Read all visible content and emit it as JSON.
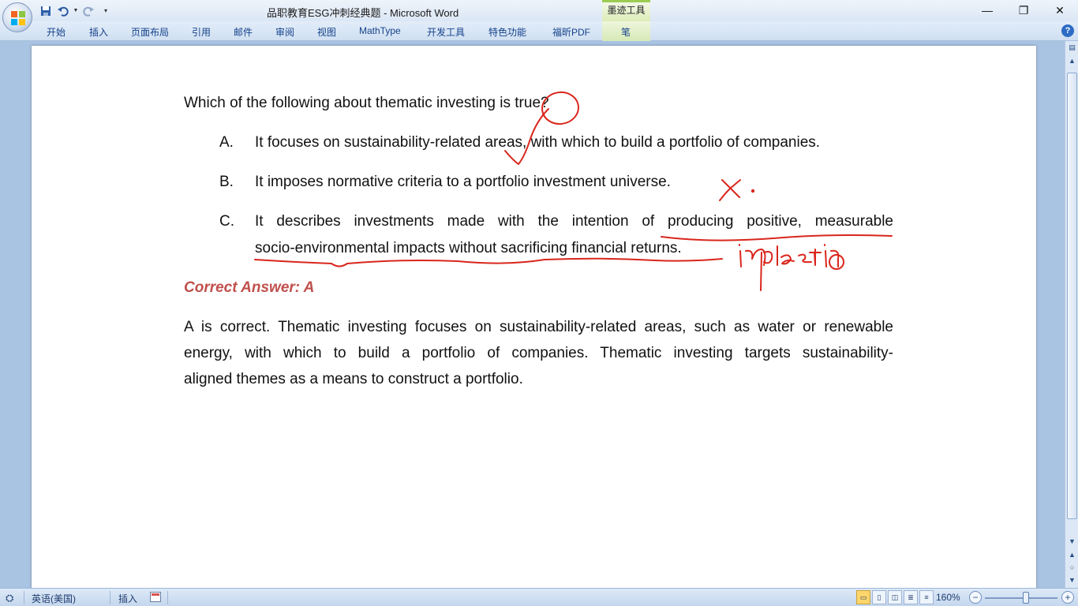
{
  "window": {
    "title": "品职教育ESG冲刺经典题 - Microsoft Word",
    "contextual_tab": "墨迹工具",
    "controls": [
      "minimize-icon",
      "restore-icon",
      "close-icon"
    ]
  },
  "quick_access": {
    "icons": [
      "save-icon",
      "undo-icon",
      "redo-icon",
      "customize-dropdown-icon"
    ]
  },
  "ribbon": {
    "tabs": [
      "开始",
      "插入",
      "页面布局",
      "引用",
      "邮件",
      "审阅",
      "视图",
      "MathType",
      "开发工具",
      "特色功能",
      "福昕PDF",
      "笔"
    ]
  },
  "document": {
    "question": "Which of the following about thematic investing is true?",
    "options": [
      {
        "label": "A.",
        "text": "It focuses on sustainability-related areas, with which to build a portfolio of companies."
      },
      {
        "label": "B.",
        "text": "It imposes normative criteria to a portfolio investment universe."
      },
      {
        "label": "C.",
        "text_line1": "It describes investments made with the intention of producing positive, measurable",
        "text_line2": "socio-environmental impacts without sacrificing financial returns."
      }
    ],
    "answer_label": "Correct Answer:  A",
    "explanation": [
      "A is correct. Thematic investing focuses on sustainability-related areas, such as water or renewable",
      "energy, with which to build a portfolio of companies. Thematic investing targets sustainability-",
      "aligned themes as a means to construct a portfolio."
    ],
    "handwriting": "impact inv"
  },
  "statusbar": {
    "language": "英语(美国)",
    "insert_mode": "插入",
    "zoom": "160%"
  },
  "colors": {
    "ink": "#d9261c",
    "answer": "#c0504d",
    "link_blue": "#15428b"
  }
}
